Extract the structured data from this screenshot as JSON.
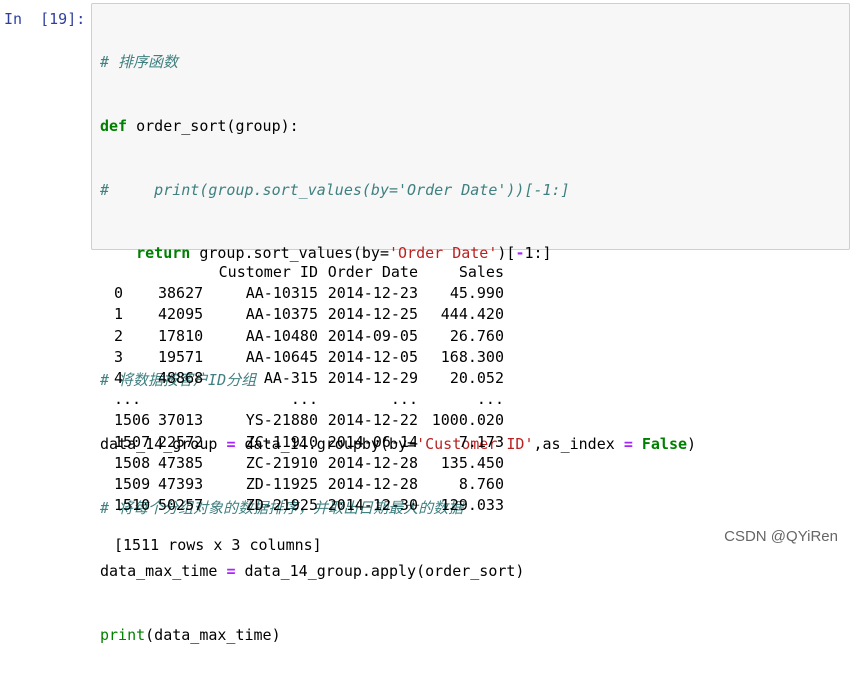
{
  "prompt": "In  [19]:",
  "code_lines": {
    "l1": "# 排序函数",
    "l2_kw": "def",
    "l2_rest": " order_sort(group):",
    "l3": "#     print(group.sort_values(by='Order Date'))[-1:]",
    "l4_kw": "return",
    "l4_a": " group.sort_values(by=",
    "l4_str": "'Order Date'",
    "l4_b": ")[",
    "l4_op": "-",
    "l4_c": "1:]",
    "l5": "",
    "l6": "# 将数据按客户ID分组",
    "l7_a": "data_14_group ",
    "l7_op": "=",
    "l7_b": " data_14.groupby(by=",
    "l7_str": "'Customer ID'",
    "l7_c": ",as_index ",
    "l7_op2": "=",
    "l7_d": " ",
    "l7_false": "False",
    "l7_e": ")",
    "l8": "# 将每个分组对象的数据排序，并取出日期最大的数据",
    "l9_a": "data_max_time ",
    "l9_op": "=",
    "l9_b": " data_14_group.apply(order_sort)",
    "l10_print": "print",
    "l10_rest": "(data_max_time)"
  },
  "table": {
    "headers": [
      "",
      "",
      "Customer ID",
      "Order Date",
      "Sales"
    ],
    "rows": [
      [
        "0",
        "38627",
        "AA-10315",
        "2014-12-23",
        "45.990"
      ],
      [
        "1",
        "42095",
        "AA-10375",
        "2014-12-25",
        "444.420"
      ],
      [
        "2",
        "17810",
        "AA-10480",
        "2014-09-05",
        "26.760"
      ],
      [
        "3",
        "19571",
        "AA-10645",
        "2014-12-05",
        "168.300"
      ],
      [
        "4",
        "48868",
        "AA-315",
        "2014-12-29",
        "20.052"
      ],
      [
        "...",
        "",
        "...",
        "...",
        "..."
      ],
      [
        "1506",
        "37013",
        "YS-21880",
        "2014-12-22",
        "1000.020"
      ],
      [
        "1507",
        "22572",
        "ZC-11910",
        "2014-06-14",
        "7.173"
      ],
      [
        "1508",
        "47385",
        "ZC-21910",
        "2014-12-28",
        "135.450"
      ],
      [
        "1509",
        "47393",
        "ZD-11925",
        "2014-12-28",
        "8.760"
      ],
      [
        "1510",
        "50257",
        "ZD-21925",
        "2014-12-30",
        "129.033"
      ]
    ]
  },
  "footer": "[1511 rows x 3 columns]",
  "watermark": "CSDN @QYiRen"
}
